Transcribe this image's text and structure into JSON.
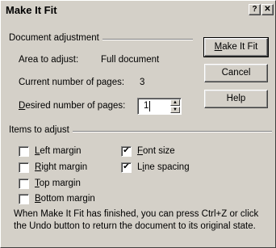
{
  "window": {
    "title": "Make It Fit",
    "help_glyph": "?",
    "close_glyph": "✕"
  },
  "document_adjustment": {
    "group_title": "Document adjustment",
    "area_label": "Area to adjust:",
    "area_value": "Full document",
    "current_pages_label": "Current number of pages:",
    "current_pages_value": "3",
    "desired_pages_label_mnemonic": "D",
    "desired_pages_label_rest": "esired number of pages:",
    "desired_pages_value": "1"
  },
  "buttons": {
    "make_it_fit_mnemonic": "M",
    "make_it_fit_rest": "ake It Fit",
    "cancel": "Cancel",
    "help": "Help"
  },
  "items_to_adjust": {
    "group_title": "Items to adjust",
    "items": [
      {
        "mnemonic": "L",
        "rest": "eft margin",
        "checked": false
      },
      {
        "mnemonic": "R",
        "rest": "ight margin",
        "checked": false
      },
      {
        "mnemonic": "T",
        "rest": "op margin",
        "checked": false
      },
      {
        "mnemonic": "B",
        "rest": "ottom margin",
        "checked": false
      },
      {
        "mnemonic": "F",
        "rest": "ont size",
        "checked": true
      },
      {
        "mnemonic": "i",
        "prefix": "L",
        "rest": "ne spacing",
        "checked": true
      }
    ],
    "check_glyph": "✔"
  },
  "note": "When Make It Fit has finished, you can press Ctrl+Z or click the Undo button to return the document to its original state.",
  "spinner": {
    "up_glyph": "▲",
    "down_glyph": "▼"
  }
}
